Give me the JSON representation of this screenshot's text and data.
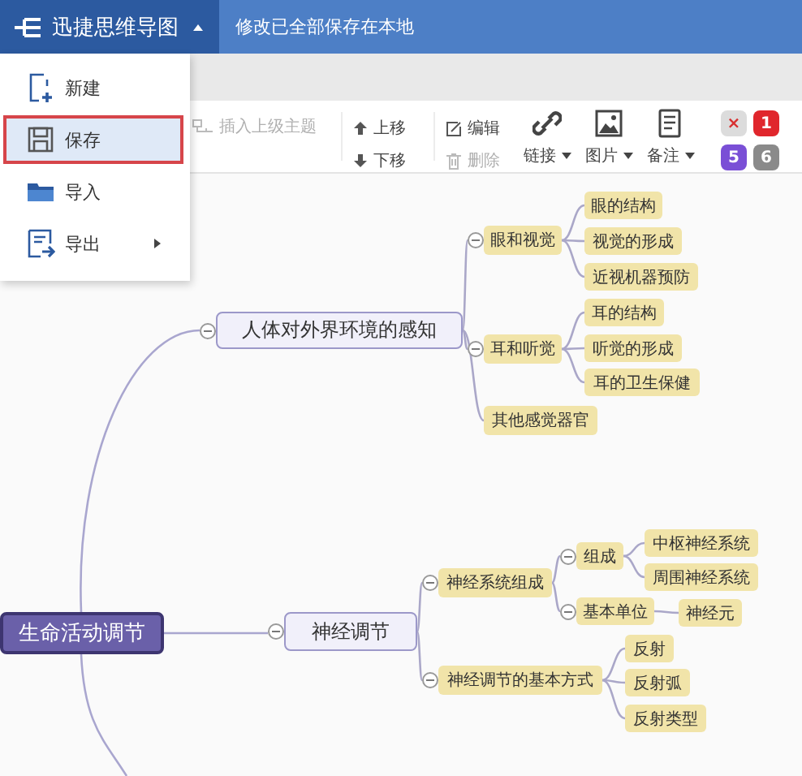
{
  "header": {
    "app_title": "迅捷思维导图",
    "menu_expanded": true,
    "status": "修改已全部保存在本地"
  },
  "menu": [
    {
      "label": "新建",
      "selected": false,
      "has_submenu": false
    },
    {
      "label": "保存",
      "selected": true,
      "has_submenu": false
    },
    {
      "label": "导入",
      "selected": false,
      "has_submenu": false
    },
    {
      "label": "导出",
      "selected": false,
      "has_submenu": true
    }
  ],
  "toolbar": {
    "insert_parent": {
      "label": "插入上级主题",
      "disabled": true
    },
    "move": [
      {
        "label": "上移",
        "disabled": false
      },
      {
        "label": "下移",
        "disabled": false
      }
    ],
    "edit": [
      {
        "label": "编辑",
        "disabled": false
      },
      {
        "label": "删除",
        "disabled": true
      }
    ],
    "dropdowns": [
      {
        "label": "链接"
      },
      {
        "label": "图片"
      },
      {
        "label": "备注"
      }
    ],
    "priorities": [
      {
        "label": "×",
        "color": "#dcdcdc"
      },
      {
        "label": "1",
        "color": "#e0262c"
      },
      {
        "label": "5",
        "color": "#7a4fd6"
      },
      {
        "label": "6",
        "color": "#8a8a8a"
      }
    ]
  },
  "mindmap": {
    "label": "生命活动调节",
    "children": [
      {
        "label": "人体对外界环境的感知",
        "children": [
          {
            "label": "眼和视觉",
            "children": [
              {
                "label": "眼的结构"
              },
              {
                "label": "视觉的形成"
              },
              {
                "label": "近视机器预防"
              }
            ]
          },
          {
            "label": "耳和听觉",
            "children": [
              {
                "label": "耳的结构"
              },
              {
                "label": "听觉的形成"
              },
              {
                "label": "耳的卫生保健"
              }
            ]
          },
          {
            "label": "其他感觉器官"
          }
        ]
      },
      {
        "label": "神经调节",
        "children": [
          {
            "label": "神经系统组成",
            "children": [
              {
                "label": "组成",
                "children": [
                  {
                    "label": "中枢神经系统"
                  },
                  {
                    "label": "周围神经系统"
                  }
                ]
              },
              {
                "label": "基本单位",
                "children": [
                  {
                    "label": "神经元"
                  }
                ]
              }
            ]
          },
          {
            "label": "神经调节的基本方式",
            "children": [
              {
                "label": "反射"
              },
              {
                "label": "反射弧"
              },
              {
                "label": "反射类型"
              }
            ]
          }
        ]
      }
    ]
  }
}
